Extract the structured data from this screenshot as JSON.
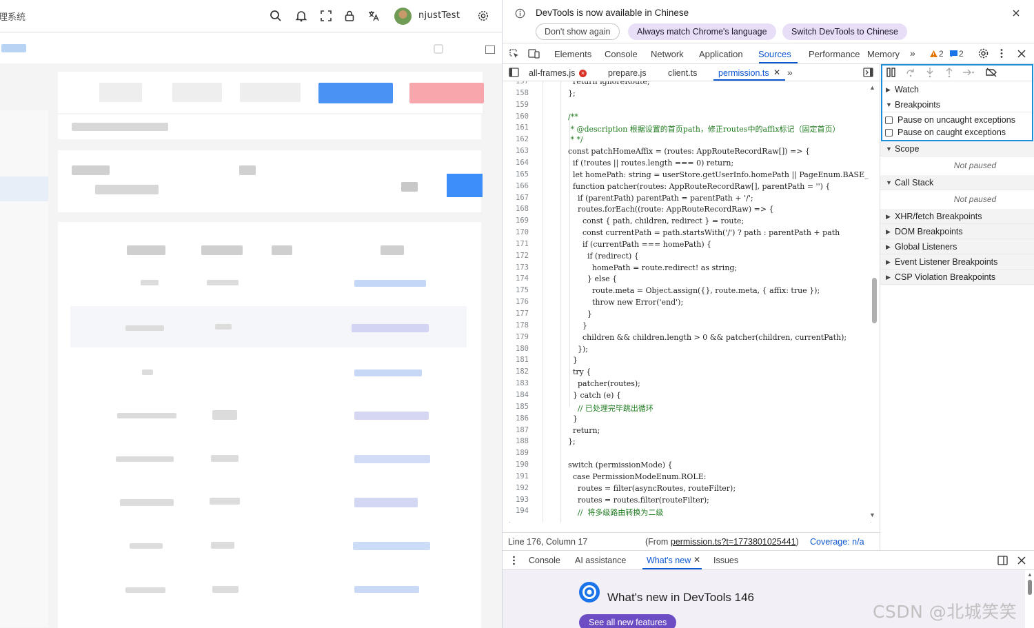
{
  "app": {
    "title": "理系统",
    "user_name": "njustTest"
  },
  "devtools": {
    "infobar": {
      "message": "DevTools is now available in Chinese",
      "dont_show": "Don't show again",
      "always_match": "Always match Chrome's language",
      "switch_lang": "Switch DevTools to Chinese"
    },
    "tabs": [
      "Elements",
      "Console",
      "Network",
      "Application",
      "Sources",
      "Performance",
      "Memory"
    ],
    "warn_count": "2",
    "msg_count": "2",
    "files": [
      "all-frames.js",
      "prepare.js",
      "client.ts",
      "permission.ts"
    ],
    "code_lines": [
      {
        "n": "157",
        "t": "    return ignoreRoute;"
      },
      {
        "n": "158",
        "t": "  };"
      },
      {
        "n": "159",
        "t": ""
      },
      {
        "n": "160",
        "t": "  /**"
      },
      {
        "n": "161",
        "t": "   * @description 根据设置的首页path，修正routes中的affix标记（固定首页）"
      },
      {
        "n": "162",
        "t": "   * */"
      },
      {
        "n": "163",
        "t": "  const patchHomeAffix = (routes: AppRouteRecordRaw[]) => {"
      },
      {
        "n": "164",
        "t": "    if (!routes || routes.length === 0) return;"
      },
      {
        "n": "165",
        "t": "    let homePath: string = userStore.getUserInfo.homePath || PageEnum.BASE_"
      },
      {
        "n": "166",
        "t": "    function patcher(routes: AppRouteRecordRaw[], parentPath = '') {"
      },
      {
        "n": "167",
        "t": "      if (parentPath) parentPath = parentPath + '/';"
      },
      {
        "n": "168",
        "t": "      routes.forEach((route: AppRouteRecordRaw) => {"
      },
      {
        "n": "169",
        "t": "        const { path, children, redirect } = route;"
      },
      {
        "n": "170",
        "t": "        const currentPath = path.startsWith('/') ? path : parentPath + path"
      },
      {
        "n": "171",
        "t": "        if (currentPath === homePath) {"
      },
      {
        "n": "172",
        "t": "          if (redirect) {"
      },
      {
        "n": "173",
        "t": "            homePath = route.redirect! as string;"
      },
      {
        "n": "174",
        "t": "          } else {"
      },
      {
        "n": "175",
        "t": "            route.meta = Object.assign({}, route.meta, { affix: true });"
      },
      {
        "n": "176",
        "t": "            throw new Error('end');"
      },
      {
        "n": "177",
        "t": "          }"
      },
      {
        "n": "178",
        "t": "        }"
      },
      {
        "n": "179",
        "t": "        children && children.length > 0 && patcher(children, currentPath);"
      },
      {
        "n": "180",
        "t": "      });"
      },
      {
        "n": "181",
        "t": "    }"
      },
      {
        "n": "182",
        "t": "    try {"
      },
      {
        "n": "183",
        "t": "      patcher(routes);"
      },
      {
        "n": "184",
        "t": "    } catch (e) {"
      },
      {
        "n": "185",
        "t": "      // 已处理完毕跳出循环"
      },
      {
        "n": "186",
        "t": "    }"
      },
      {
        "n": "187",
        "t": "    return;"
      },
      {
        "n": "188",
        "t": "  };"
      },
      {
        "n": "189",
        "t": ""
      },
      {
        "n": "190",
        "t": "  switch (permissionMode) {"
      },
      {
        "n": "191",
        "t": "    case PermissionModeEnum.ROLE:"
      },
      {
        "n": "192",
        "t": "      routes = filter(asyncRoutes, routeFilter);"
      },
      {
        "n": "193",
        "t": "      routes = routes.filter(routeFilter);"
      },
      {
        "n": "194",
        "t": "      //  将多级路由转换为二级"
      }
    ],
    "status": {
      "position": "Line 176, Column 17",
      "from_prefix": "(From ",
      "from_link": "permission.ts?t=1773801025441",
      "from_suffix": ")",
      "coverage": "Coverage: n/a"
    },
    "debugger": {
      "watch": "Watch",
      "breakpoints": "Breakpoints",
      "pause_uncaught": "Pause on uncaught exceptions",
      "pause_caught": "Pause on caught exceptions",
      "scope": "Scope",
      "scope_empty": "Not paused",
      "call_stack": "Call Stack",
      "call_stack_empty": "Not paused",
      "sections": [
        "XHR/fetch Breakpoints",
        "DOM Breakpoints",
        "Global Listeners",
        "Event Listener Breakpoints",
        "CSP Violation Breakpoints"
      ]
    },
    "drawer": {
      "tabs": [
        "Console",
        "AI assistance",
        "What's new",
        "Issues"
      ],
      "headline": "What's new in DevTools 146",
      "see_all": "See all new features"
    }
  },
  "watermark": "CSDN @北城笑笑"
}
